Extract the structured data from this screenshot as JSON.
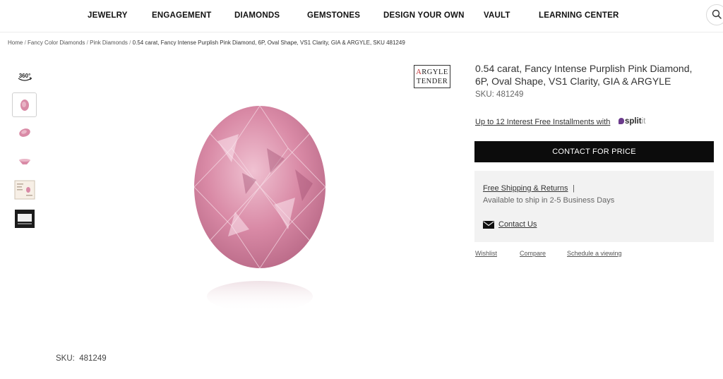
{
  "nav": {
    "items": [
      "JEWELRY",
      "ENGAGEMENT",
      "DIAMONDS",
      "GEMSTONES",
      "DESIGN YOUR OWN",
      "VAULT",
      "LEARNING CENTER"
    ],
    "search_icon": "search-icon"
  },
  "breadcrumb": {
    "home": "Home",
    "category": "Fancy Color Diamonds",
    "subcategory": "Pink Diamonds",
    "current": "0.54 carat, Fancy Intense Purplish Pink Diamond, 6P, Oval Shape, VS1 Clarity, GIA & ARGYLE, SKU 481249",
    "separator": "/"
  },
  "gallery": {
    "thumb_360_label": "360°",
    "thumbnails": [
      "360-view",
      "front-view",
      "side-view",
      "profile-view",
      "certificate",
      "display-box"
    ]
  },
  "badge": {
    "line1_first": "A",
    "line1_rest": "RGYLE",
    "line2": "TENDER"
  },
  "product": {
    "title": "0.54 carat, Fancy Intense Purplish Pink Diamond, 6P, Oval Shape, VS1 Clarity, GIA & ARGYLE",
    "sku_label": "SKU:",
    "sku_value": "481249",
    "installments_text": "Up to 12 Interest Free Installments with",
    "splitit_main": "split",
    "splitit_suffix": "it",
    "cta_label": "CONTACT FOR PRICE"
  },
  "shipping": {
    "link": "Free Shipping & Returns",
    "pipe": "|",
    "status": "Available to ship in 2-5 Business Days",
    "contact_label": "Contact Us"
  },
  "actions": [
    "Wishlist",
    "Compare",
    "Schedule a viewing"
  ],
  "footer_sku": {
    "label": "SKU:",
    "value": "481249"
  },
  "colors": {
    "diamond_pink": "#d98aa6",
    "cta_bg": "#0c0c0c",
    "info_box_bg": "#f2f2f2",
    "argyle_red": "#c0282d"
  }
}
